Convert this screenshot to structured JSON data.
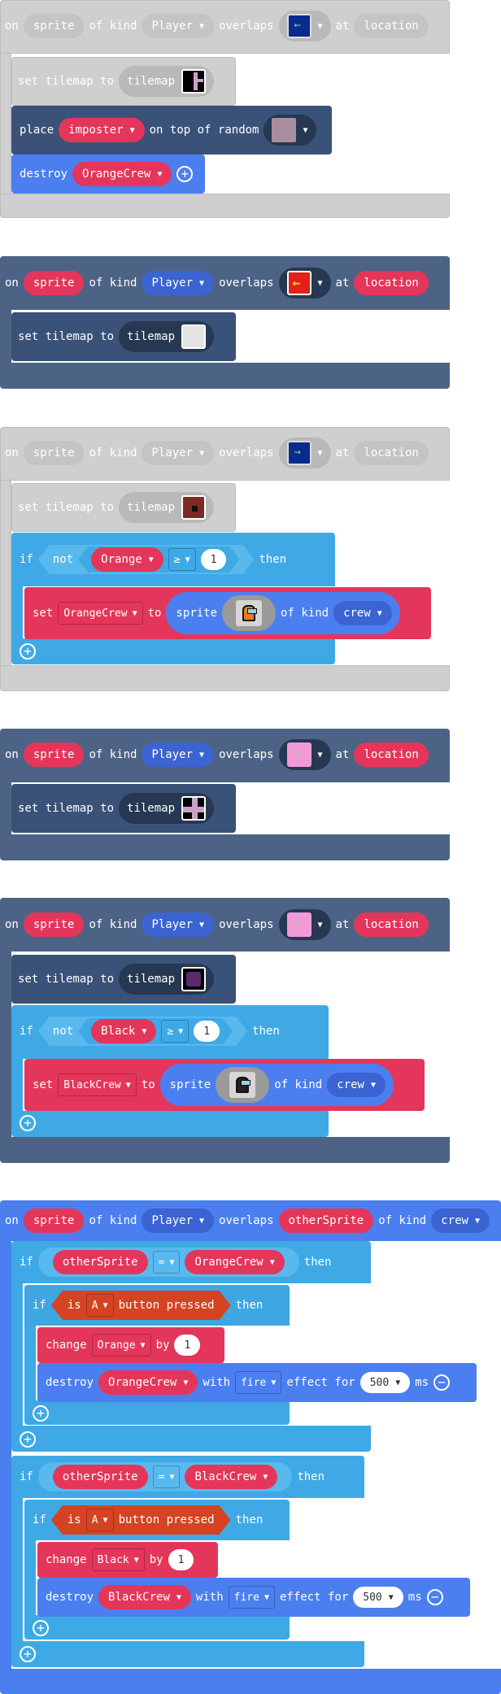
{
  "common": {
    "on": "on",
    "sprite": "sprite",
    "of_kind": "of kind",
    "player": "Player",
    "overlaps": "overlaps",
    "at": "at",
    "location": "location",
    "set_tilemap_to": "set tilemap to",
    "tilemap": "tilemap",
    "if": "if",
    "not": "not",
    "then": "then",
    "gte": "≥",
    "one": "1",
    "set": "set",
    "to": "to",
    "crew": "crew",
    "place": "place",
    "on_top_of_random": "on top of random",
    "destroy": "destroy",
    "eq": "=",
    "is": "is",
    "a": "A",
    "button_pressed": "button pressed",
    "change": "change",
    "by": "by",
    "with": "with",
    "fire": "fire",
    "effect_for": "effect for",
    "ms": "ms",
    "five_hundred": "500",
    "other_sprite": "otherSprite"
  },
  "blocks": {
    "b1": {
      "place_var": "imposter",
      "destroy_var": "OrangeCrew"
    },
    "b3": {
      "cond_var": "Orange",
      "set_var": "OrangeCrew"
    },
    "b5": {
      "cond_var": "Black",
      "set_var": "BlackCrew"
    },
    "b6": {
      "if1_var": "OrangeCrew",
      "change1_var": "Orange",
      "destroy1_var": "OrangeCrew",
      "if2_var": "BlackCrew",
      "change2_var": "Black",
      "destroy2_var": "BlackCrew"
    }
  },
  "colors": {
    "event_dark": "#4c6385",
    "logic": "#3fa9e6",
    "variable": "#e4365a",
    "sprite": "#4b7ff0",
    "controller": "#d54322",
    "disabled": "#cfcfcf"
  },
  "icons": [
    "arrow-left-tile-icon",
    "arrow-right-tile-icon",
    "orange-crewmate-icon",
    "black-crewmate-icon",
    "add-icon",
    "remove-icon",
    "caret-down-icon"
  ]
}
